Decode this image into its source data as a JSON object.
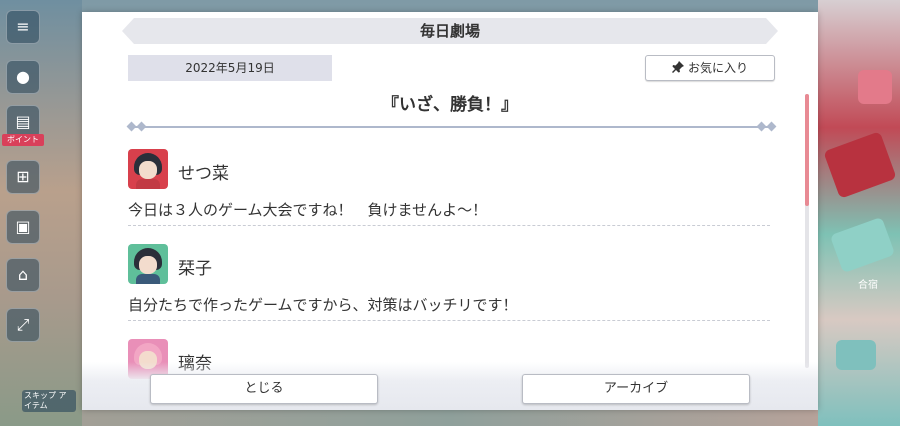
{
  "header": {
    "title": "毎日劇場"
  },
  "date": "2022年5月19日",
  "favorite_button": {
    "label": "お気に入り",
    "icon": "pin-icon"
  },
  "episode": {
    "title": "『いざ、勝負！』"
  },
  "entries": [
    {
      "speaker": "せつ菜",
      "line": "今日は３人のゲーム大会ですね！　負けませんよ～！",
      "avatar_color": "#d8404c"
    },
    {
      "speaker": "栞子",
      "line": "自分たちで作ったゲームですから、対策はバッチリです！",
      "avatar_color": "#5fbf9a"
    },
    {
      "speaker": "璃奈",
      "line": "",
      "avatar_color": "#e98fb8"
    }
  ],
  "footer": {
    "close_label": "とじる",
    "archive_label": "アーカイブ"
  },
  "side_menu": {
    "tag": "ボイント",
    "bottom_label": "スキップ アイテム"
  },
  "right_panel": {
    "text": "合宿"
  },
  "colors": {
    "scroll_thumb": "#e88a94",
    "title_banner": "#e6e7ec"
  }
}
